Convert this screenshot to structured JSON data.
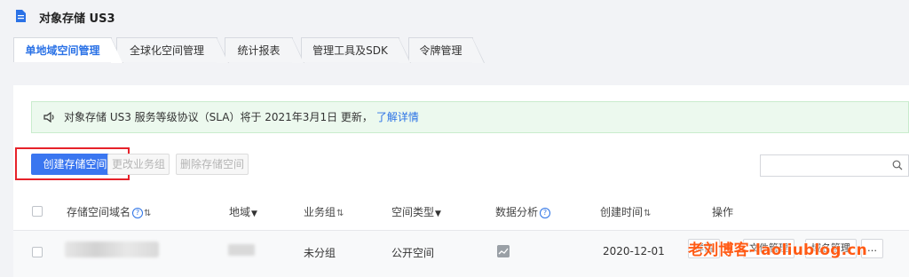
{
  "title": "对象存储 US3",
  "tabs": [
    {
      "label": "单地域空间管理"
    },
    {
      "label": "全球化空间管理"
    },
    {
      "label": "统计报表"
    },
    {
      "label": "管理工具及SDK"
    },
    {
      "label": "令牌管理"
    }
  ],
  "notice": {
    "text": "对象存储 US3 服务等级协议（SLA）将于 2021年3月1日 更新，",
    "link": "了解详情"
  },
  "toolbar": {
    "create_label": "创建存储空间",
    "change_group_label": "更改业务组",
    "delete_label": "删除存储空间"
  },
  "search": {
    "placeholder": ""
  },
  "table": {
    "headers": {
      "name": "存储空间域名",
      "region": "地域",
      "group": "业务组",
      "type": "空间类型",
      "analysis": "数据分析",
      "created": "创建时间",
      "ops": "操作"
    },
    "rows": [
      {
        "group": "未分组",
        "type": "公开空间",
        "created": "2020-12-01",
        "op1": "详情",
        "op2": "文件管理",
        "op3": "域名管理",
        "op4": "…"
      }
    ]
  },
  "watermark": "老刘博客-laoliublog.cn",
  "colors": {
    "accent": "#3a76f0",
    "highlight": "#e6222a",
    "notice_bg": "#ecf9ee"
  }
}
